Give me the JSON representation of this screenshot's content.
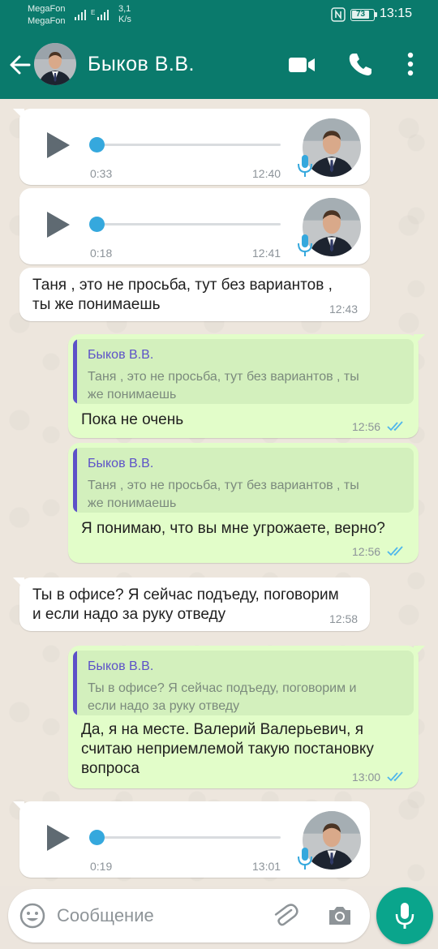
{
  "status_bar": {
    "carrier1": "MegaFon",
    "carrier2": "MegaFon",
    "speed_value": "3,1",
    "speed_unit": "K/s",
    "battery": "73",
    "time": "13:15"
  },
  "header": {
    "contact_name": "Быков В.В.",
    "icons": [
      "back-arrow-icon",
      "video-call-icon",
      "phone-icon",
      "more-vert-icon"
    ]
  },
  "messages": [
    {
      "type": "voice",
      "direction": "in",
      "duration": "0:33",
      "time": "12:40"
    },
    {
      "type": "voice",
      "direction": "in",
      "duration": "0:18",
      "time": "12:41"
    },
    {
      "type": "text",
      "direction": "in",
      "lines": [
        "Таня , это не просьба, тут без вариантов ,",
        "ты же понимаешь"
      ],
      "time": "12:43"
    },
    {
      "type": "reply",
      "direction": "out",
      "quote_author": "Быков В.В.",
      "quote_lines": [
        "Таня , это не просьба, тут без вариантов , ты",
        "же понимаешь"
      ],
      "lines": [
        "Пока не очень"
      ],
      "time": "12:56",
      "status": "read"
    },
    {
      "type": "reply",
      "direction": "out",
      "quote_author": "Быков В.В.",
      "quote_lines": [
        "Таня , это не просьба, тут без вариантов , ты",
        "же понимаешь"
      ],
      "lines": [
        "Я понимаю, что вы мне угрожаете, верно?"
      ],
      "time": "12:56",
      "status": "read"
    },
    {
      "type": "text",
      "direction": "in",
      "lines": [
        "Ты в офисе? Я сейчас подъеду, поговорим",
        "и если надо за руку отведу"
      ],
      "time": "12:58"
    },
    {
      "type": "reply",
      "direction": "out",
      "quote_author": "Быков В.В.",
      "quote_lines": [
        "Ты в офисе? Я сейчас подъеду, поговорим и",
        "если надо за руку отведу"
      ],
      "lines": [
        "Да, я на месте. Валерий Валерьевич, я",
        "считаю неприемлемой такую постановку",
        "вопроса"
      ],
      "time": "13:00",
      "status": "read"
    },
    {
      "type": "voice",
      "direction": "in",
      "duration": "0:19",
      "time": "13:01"
    }
  ],
  "composer": {
    "placeholder": "Сообщение",
    "icons": [
      "emoji-icon",
      "attach-icon",
      "camera-icon",
      "mic-icon"
    ]
  },
  "colors": {
    "header": "#0a7a6c",
    "outgoing_bubble": "#e2fdc9",
    "incoming_bubble": "#ffffff",
    "quote_accent": "#5d52c8",
    "voice_accent": "#35a8dd",
    "read_ticks": "#4fb6ec",
    "fab": "#0aa58c"
  }
}
